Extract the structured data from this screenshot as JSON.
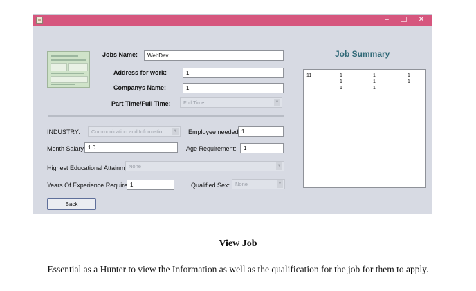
{
  "window": {
    "controls": {
      "minimize": "–",
      "close": "✕"
    }
  },
  "form": {
    "jobs_name": {
      "label": "Jobs Name:",
      "value": "WebDev"
    },
    "address": {
      "label": "Address for work:",
      "value": "1"
    },
    "company": {
      "label": "Companys Name:",
      "value": "1"
    },
    "part_full": {
      "label": "Part Time/Full Time:",
      "value": "Full Time"
    },
    "industry": {
      "label": "INDUSTRY:",
      "value": "Communication and Informatio..."
    },
    "employee_needed": {
      "label": "Employee needed:",
      "value": "1"
    },
    "month_salary": {
      "label": "Month Salary:",
      "value": "1.0"
    },
    "age_requirement": {
      "label": "Age Requirement:",
      "value": "1"
    },
    "education": {
      "label": "Highest Educational Attainment:",
      "value": "None"
    },
    "experience": {
      "label": "Years Of Experience Required:",
      "value": "1"
    },
    "qualified_sex": {
      "label": "Qualified Sex:",
      "value": "None"
    },
    "back_button": "Back"
  },
  "summary": {
    "title": "Job Summary",
    "rows": [
      [
        "11",
        "1",
        "1",
        "1"
      ],
      [
        "",
        "1",
        "1",
        "1"
      ],
      [
        "",
        "1",
        "1",
        ""
      ]
    ]
  },
  "caption": "View Job",
  "description": "Essential as a Hunter to view the Information as well as the qualification for the job for them to apply."
}
